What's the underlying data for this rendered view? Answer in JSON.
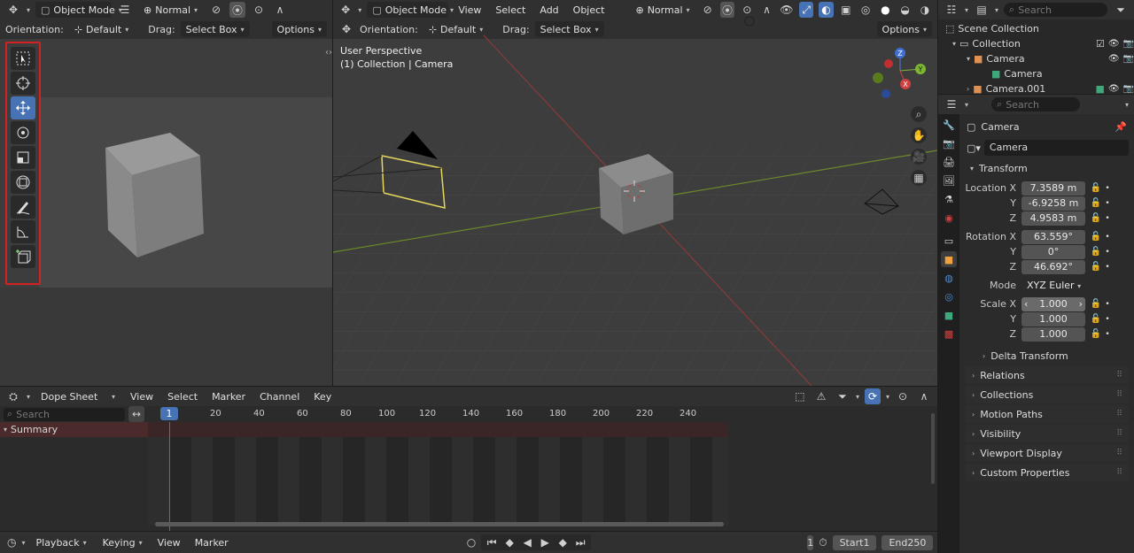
{
  "left_editor": {
    "mode": "Object Mode",
    "shading": "Normal",
    "orientation_label": "Orientation:",
    "orientation_value": "Default",
    "drag_label": "Drag:",
    "drag_value": "Select Box",
    "options": "Options"
  },
  "toolbar": {
    "tools": [
      "select-box",
      "cursor",
      "move",
      "rotate",
      "scale",
      "transform",
      "annotate",
      "measure",
      "add-cube"
    ],
    "active_tool": "move",
    "highlight_color": "#d32020"
  },
  "viewport": {
    "mode": "Object Mode",
    "menus": [
      "View",
      "Select",
      "Add",
      "Object"
    ],
    "shading": "Normal",
    "orientation_label": "Orientation:",
    "orientation_value": "Default",
    "drag_label": "Drag:",
    "drag_value": "Select Box",
    "options": "Options",
    "overlay_title": "User Perspective",
    "overlay_subtitle": "(1) Collection | Camera",
    "gizmo": {
      "z": "Z",
      "y": "Y",
      "x": "X"
    }
  },
  "outliner": {
    "search_placeholder": "Search",
    "scene_collection": "Scene Collection",
    "items": [
      {
        "label": "Collection",
        "level": 1
      },
      {
        "label": "Camera",
        "level": 2
      },
      {
        "label": "Camera",
        "level": 3
      },
      {
        "label": "Camera.001",
        "level": 2
      }
    ]
  },
  "properties": {
    "search_placeholder": "Search",
    "breadcrumb": "Camera",
    "object_name": "Camera",
    "transform_title": "Transform",
    "location": {
      "label": "Location X",
      "x": "7.3589 m",
      "y": "-6.9258 m",
      "z": "4.9583 m"
    },
    "rotation": {
      "label": "Rotation X",
      "x": "63.559°",
      "y": "0°",
      "z": "46.692°"
    },
    "mode": {
      "label": "Mode",
      "value": "XYZ Euler"
    },
    "scale": {
      "label": "Scale X",
      "x": "1.000",
      "y": "1.000",
      "z": "1.000"
    },
    "axis_y": "Y",
    "axis_z": "Z",
    "delta_transform": "Delta Transform",
    "panels": [
      "Relations",
      "Collections",
      "Motion Paths",
      "Visibility",
      "Viewport Display",
      "Custom Properties"
    ]
  },
  "dopesheet": {
    "editor": "Dope Sheet",
    "menus": [
      "View",
      "Select",
      "Marker",
      "Channel",
      "Key"
    ],
    "search_placeholder": "Search",
    "summary": "Summary",
    "current_frame_marker": "1",
    "ticks": [
      "20",
      "40",
      "60",
      "80",
      "100",
      "120",
      "140",
      "160",
      "180",
      "200",
      "220",
      "240"
    ]
  },
  "timeline": {
    "playback": "Playback",
    "keying": "Keying",
    "view": "View",
    "marker": "Marker",
    "current_frame": "1",
    "start_label": "Start",
    "start_value": "1",
    "end_label": "End",
    "end_value": "250"
  }
}
